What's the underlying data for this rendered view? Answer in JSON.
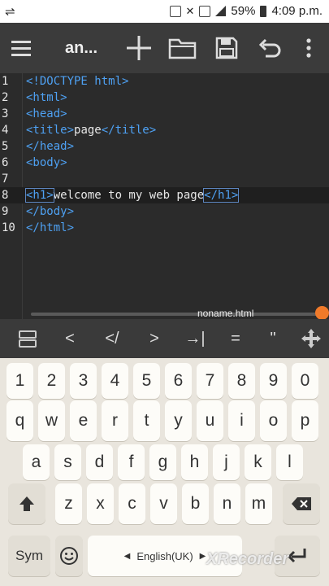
{
  "status_bar": {
    "battery": "59%",
    "time": "4:09 p.m."
  },
  "toolbar": {
    "title": "an..."
  },
  "editor": {
    "lines": [
      {
        "num": "1",
        "segments": [
          {
            "c": "tag",
            "t": "<!DOCTYPE html>"
          }
        ]
      },
      {
        "num": "2",
        "segments": [
          {
            "c": "tag",
            "t": "<html>"
          }
        ]
      },
      {
        "num": "3",
        "segments": [
          {
            "c": "tag",
            "t": "<head>"
          }
        ]
      },
      {
        "num": "4",
        "segments": [
          {
            "c": "tag",
            "t": "<title>"
          },
          {
            "c": "txt",
            "t": "page"
          },
          {
            "c": "tag",
            "t": "</title>"
          }
        ]
      },
      {
        "num": "5",
        "segments": [
          {
            "c": "tag",
            "t": "</head>"
          }
        ]
      },
      {
        "num": "6",
        "segments": [
          {
            "c": "tag",
            "t": "<body>"
          }
        ]
      },
      {
        "num": "7",
        "segments": []
      },
      {
        "num": "8",
        "segments": [
          {
            "c": "tag hl",
            "t": "<h1>"
          },
          {
            "c": "txt",
            "t": "welcome to my web page"
          },
          {
            "c": "tag hl",
            "t": "</h1>"
          }
        ]
      },
      {
        "num": "9",
        "segments": [
          {
            "c": "tag",
            "t": "</body>"
          }
        ]
      },
      {
        "num": "10",
        "segments": [
          {
            "c": "tag",
            "t": "</html>"
          }
        ]
      }
    ],
    "active_line": 8,
    "filename": "noname.html"
  },
  "symbol_bar": {
    "symbols": [
      "<",
      "</",
      ">",
      "→|",
      "=",
      "\""
    ]
  },
  "keyboard": {
    "row_numbers": [
      "1",
      "2",
      "3",
      "4",
      "5",
      "6",
      "7",
      "8",
      "9",
      "0"
    ],
    "row_q": [
      "q",
      "w",
      "e",
      "r",
      "t",
      "y",
      "u",
      "i",
      "o",
      "p"
    ],
    "row_a": [
      "a",
      "s",
      "d",
      "f",
      "g",
      "h",
      "j",
      "k",
      "l"
    ],
    "row_z": [
      "z",
      "x",
      "c",
      "v",
      "b",
      "n",
      "m"
    ],
    "sym_label": "Sym",
    "language": "English(UK)"
  },
  "watermark": "XRecorder"
}
